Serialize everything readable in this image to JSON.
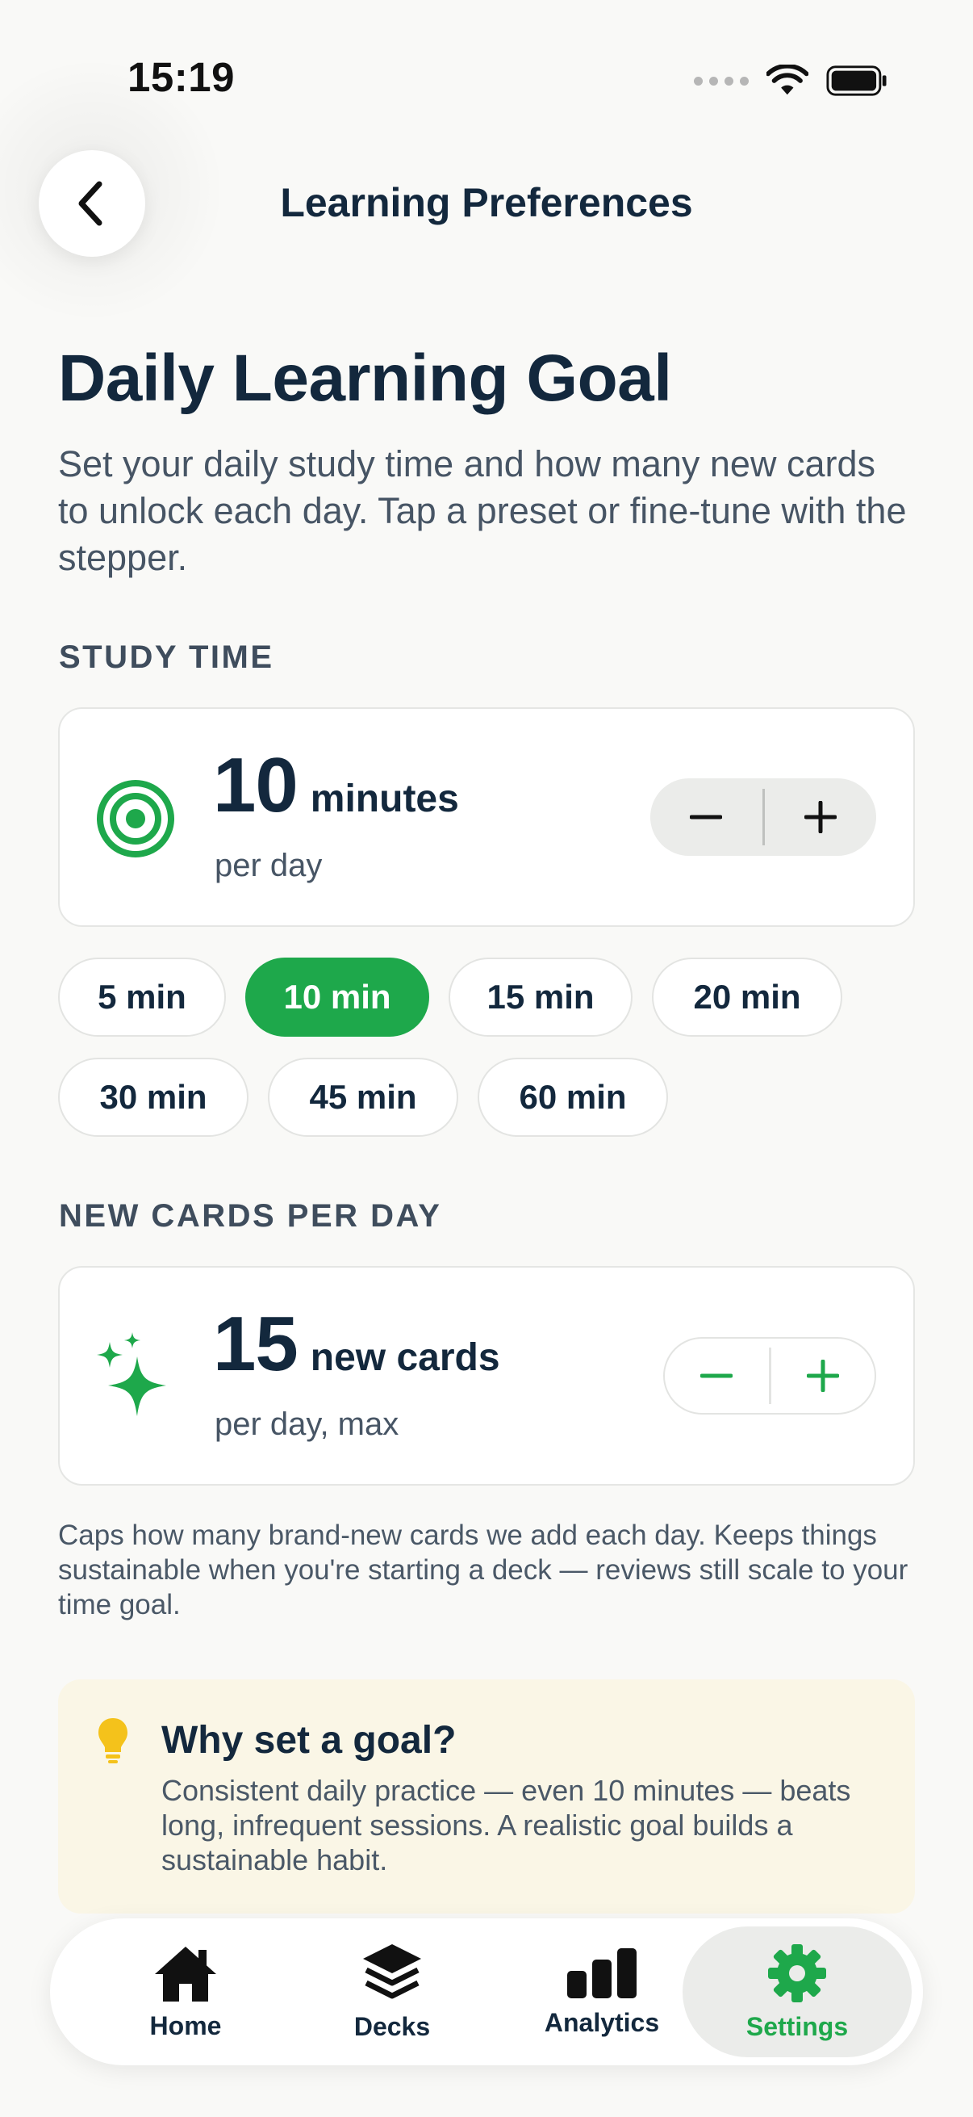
{
  "status_bar": {
    "time": "15:19"
  },
  "header": {
    "title": "Learning Preferences"
  },
  "page": {
    "title": "Daily Learning Goal",
    "description": "Set your daily study time and how many new cards to unlock each day. Tap a preset or fine-tune with the stepper."
  },
  "study_time": {
    "section_label": "STUDY TIME",
    "value": "10",
    "unit": "minutes",
    "sub": "per day",
    "decrement": "−",
    "increment": "+",
    "presets": [
      "5 min",
      "10 min",
      "15 min",
      "20 min",
      "30 min",
      "45 min",
      "60 min"
    ],
    "selected_preset": "10 min"
  },
  "new_cards": {
    "section_label": "NEW CARDS PER DAY",
    "value": "15",
    "unit": "new cards",
    "sub": "per day, max",
    "decrement": "−",
    "increment": "+",
    "help": "Caps how many brand-new cards we add each day. Keeps things sustainable when you're starting a deck — reviews still scale to your time goal."
  },
  "tip": {
    "title": "Why set a goal?",
    "body": "Consistent daily practice — even 10 minutes — beats long, infrequent sessions. A realistic goal builds a sustainable habit."
  },
  "tabbar": {
    "items": [
      {
        "label": "Home",
        "icon": "home-icon"
      },
      {
        "label": "Decks",
        "icon": "layers-icon"
      },
      {
        "label": "Analytics",
        "icon": "bar-chart-icon"
      },
      {
        "label": "Settings",
        "icon": "gear-icon"
      }
    ],
    "active": "Settings"
  },
  "colors": {
    "accent": "#1ea84b",
    "text": "#13283d",
    "muted": "#475565",
    "tip_bg": "#faf6e6",
    "bulb": "#f4c21b"
  }
}
